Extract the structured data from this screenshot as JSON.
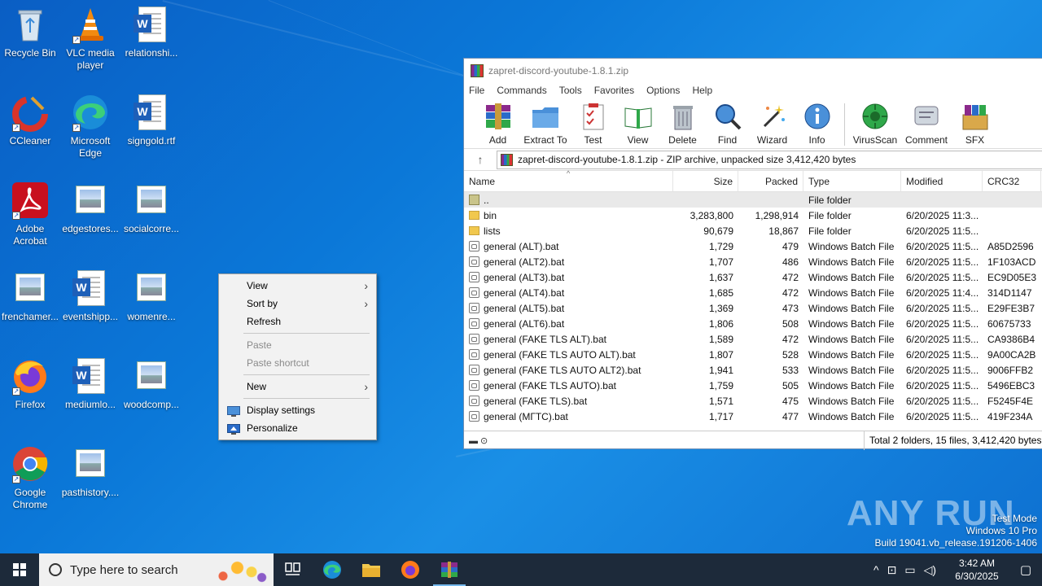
{
  "desktop": {
    "icons": [
      {
        "label": "Recycle Bin"
      },
      {
        "label": "VLC media player"
      },
      {
        "label": "relationshi..."
      },
      {
        "label": "CCleaner"
      },
      {
        "label": "Microsoft Edge"
      },
      {
        "label": "signgold.rtf"
      },
      {
        "label": "Adobe Acrobat"
      },
      {
        "label": "edgestores..."
      },
      {
        "label": "socialcorre..."
      },
      {
        "label": "frenchamer..."
      },
      {
        "label": "eventshipp..."
      },
      {
        "label": "womenre..."
      },
      {
        "label": "Firefox"
      },
      {
        "label": "mediumlo..."
      },
      {
        "label": "woodcomp..."
      },
      {
        "label": "Google Chrome"
      },
      {
        "label": "pasthistory...."
      }
    ]
  },
  "context_menu": {
    "view": "View",
    "sort_by": "Sort by",
    "refresh": "Refresh",
    "paste": "Paste",
    "paste_shortcut": "Paste shortcut",
    "new": "New",
    "display_settings": "Display settings",
    "personalize": "Personalize"
  },
  "winrar": {
    "title": "zapret-discord-youtube-1.8.1.zip",
    "menu": [
      "File",
      "Commands",
      "Tools",
      "Favorites",
      "Options",
      "Help"
    ],
    "toolbar": [
      "Add",
      "Extract To",
      "Test",
      "View",
      "Delete",
      "Find",
      "Wizard",
      "Info",
      "VirusScan",
      "Comment",
      "SFX"
    ],
    "address": "zapret-discord-youtube-1.8.1.zip - ZIP archive, unpacked size 3,412,420 bytes",
    "columns": {
      "name": "Name",
      "size": "Size",
      "packed": "Packed",
      "type": "Type",
      "modified": "Modified",
      "crc": "CRC32"
    },
    "rows": [
      {
        "name": "..",
        "size": "",
        "packed": "",
        "type": "File folder",
        "modified": "",
        "crc": "",
        "kind": "up"
      },
      {
        "name": "bin",
        "size": "3,283,800",
        "packed": "1,298,914",
        "type": "File folder",
        "modified": "6/20/2025 11:3...",
        "crc": "",
        "kind": "folder"
      },
      {
        "name": "lists",
        "size": "90,679",
        "packed": "18,867",
        "type": "File folder",
        "modified": "6/20/2025 11:5...",
        "crc": "",
        "kind": "folder"
      },
      {
        "name": "general (ALT).bat",
        "size": "1,729",
        "packed": "479",
        "type": "Windows Batch File",
        "modified": "6/20/2025 11:5...",
        "crc": "A85D2596",
        "kind": "bat"
      },
      {
        "name": "general (ALT2).bat",
        "size": "1,707",
        "packed": "486",
        "type": "Windows Batch File",
        "modified": "6/20/2025 11:5...",
        "crc": "1F103ACD",
        "kind": "bat"
      },
      {
        "name": "general (ALT3).bat",
        "size": "1,637",
        "packed": "472",
        "type": "Windows Batch File",
        "modified": "6/20/2025 11:5...",
        "crc": "EC9D05E3",
        "kind": "bat"
      },
      {
        "name": "general (ALT4).bat",
        "size": "1,685",
        "packed": "472",
        "type": "Windows Batch File",
        "modified": "6/20/2025 11:4...",
        "crc": "314D1147",
        "kind": "bat"
      },
      {
        "name": "general (ALT5).bat",
        "size": "1,369",
        "packed": "473",
        "type": "Windows Batch File",
        "modified": "6/20/2025 11:5...",
        "crc": "E29FE3B7",
        "kind": "bat"
      },
      {
        "name": "general (ALT6).bat",
        "size": "1,806",
        "packed": "508",
        "type": "Windows Batch File",
        "modified": "6/20/2025 11:5...",
        "crc": "60675733",
        "kind": "bat"
      },
      {
        "name": "general (FAKE TLS ALT).bat",
        "size": "1,589",
        "packed": "472",
        "type": "Windows Batch File",
        "modified": "6/20/2025 11:5...",
        "crc": "CA9386B4",
        "kind": "bat"
      },
      {
        "name": "general (FAKE TLS AUTO ALT).bat",
        "size": "1,807",
        "packed": "528",
        "type": "Windows Batch File",
        "modified": "6/20/2025 11:5...",
        "crc": "9A00CA2B",
        "kind": "bat"
      },
      {
        "name": "general (FAKE TLS AUTO ALT2).bat",
        "size": "1,941",
        "packed": "533",
        "type": "Windows Batch File",
        "modified": "6/20/2025 11:5...",
        "crc": "9006FFB2",
        "kind": "bat"
      },
      {
        "name": "general (FAKE TLS AUTO).bat",
        "size": "1,759",
        "packed": "505",
        "type": "Windows Batch File",
        "modified": "6/20/2025 11:5...",
        "crc": "5496EBC3",
        "kind": "bat"
      },
      {
        "name": "general (FAKE TLS).bat",
        "size": "1,571",
        "packed": "475",
        "type": "Windows Batch File",
        "modified": "6/20/2025 11:5...",
        "crc": "F5245F4E",
        "kind": "bat"
      },
      {
        "name": "general (МГТС).bat",
        "size": "1,717",
        "packed": "477",
        "type": "Windows Batch File",
        "modified": "6/20/2025 11:5...",
        "crc": "419F234A",
        "kind": "bat"
      }
    ],
    "status": "Total 2 folders, 15 files, 3,412,420 bytes"
  },
  "watermark": {
    "brand": "ANY RUN",
    "line1": "Test Mode",
    "line2": "Windows 10 Pro",
    "line3": "Build 19041.vb_release.191206-1406"
  },
  "taskbar": {
    "search_placeholder": "Type here to search",
    "time": "3:42 AM",
    "date": "6/30/2025"
  }
}
